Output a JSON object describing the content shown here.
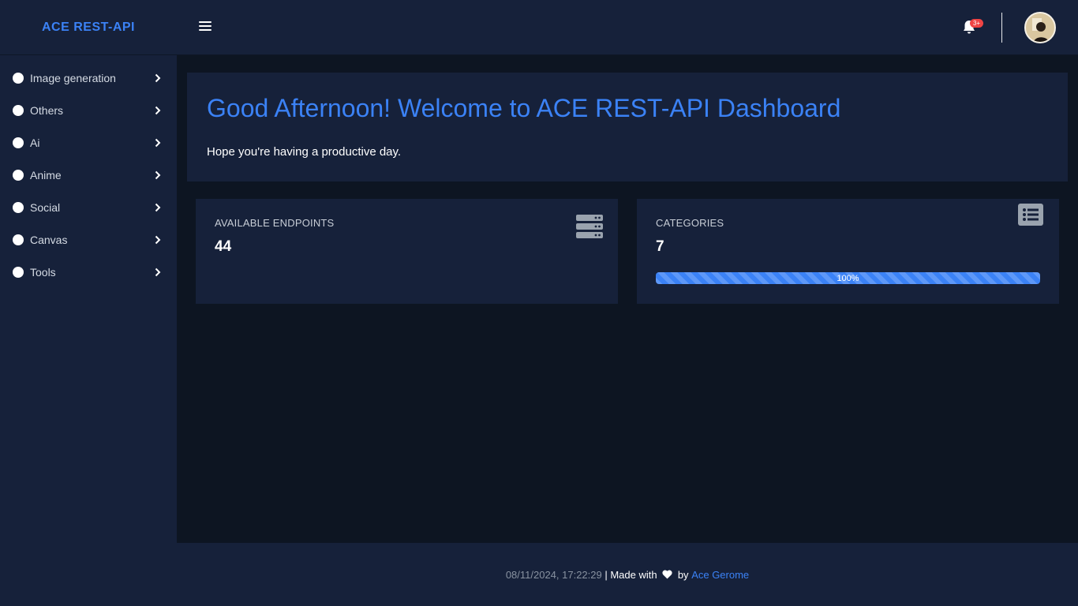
{
  "header": {
    "brand": "ACE REST-API",
    "menu_icon": "hamburger-icon",
    "notification_icon": "bell-icon",
    "notification_badge": "3+",
    "avatar": "user-avatar"
  },
  "sidebar": {
    "items": [
      {
        "label": "Image generation"
      },
      {
        "label": "Others"
      },
      {
        "label": "Ai"
      },
      {
        "label": "Anime"
      },
      {
        "label": "Social"
      },
      {
        "label": "Canvas"
      },
      {
        "label": "Tools"
      }
    ]
  },
  "welcome": {
    "title": "Good Afternoon! Welcome to ACE REST-API Dashboard",
    "subtitle": "Hope you're having a productive day."
  },
  "cards": {
    "endpoints": {
      "label": "AVAILABLE ENDPOINTS",
      "value": "44",
      "icon": "server-icon"
    },
    "categories": {
      "label": "CATEGORIES",
      "value": "7",
      "icon": "list-icon",
      "progress_label": "100%",
      "progress": 1.0
    }
  },
  "footer": {
    "timestamp": "08/11/2024, 17:22:29",
    "separator": " | Made with ",
    "by": " by ",
    "author": "Ace Gerome"
  },
  "colors": {
    "accent": "#3b82f6",
    "panel": "#16213a",
    "background": "#0d1522",
    "badge": "#ef4444"
  }
}
